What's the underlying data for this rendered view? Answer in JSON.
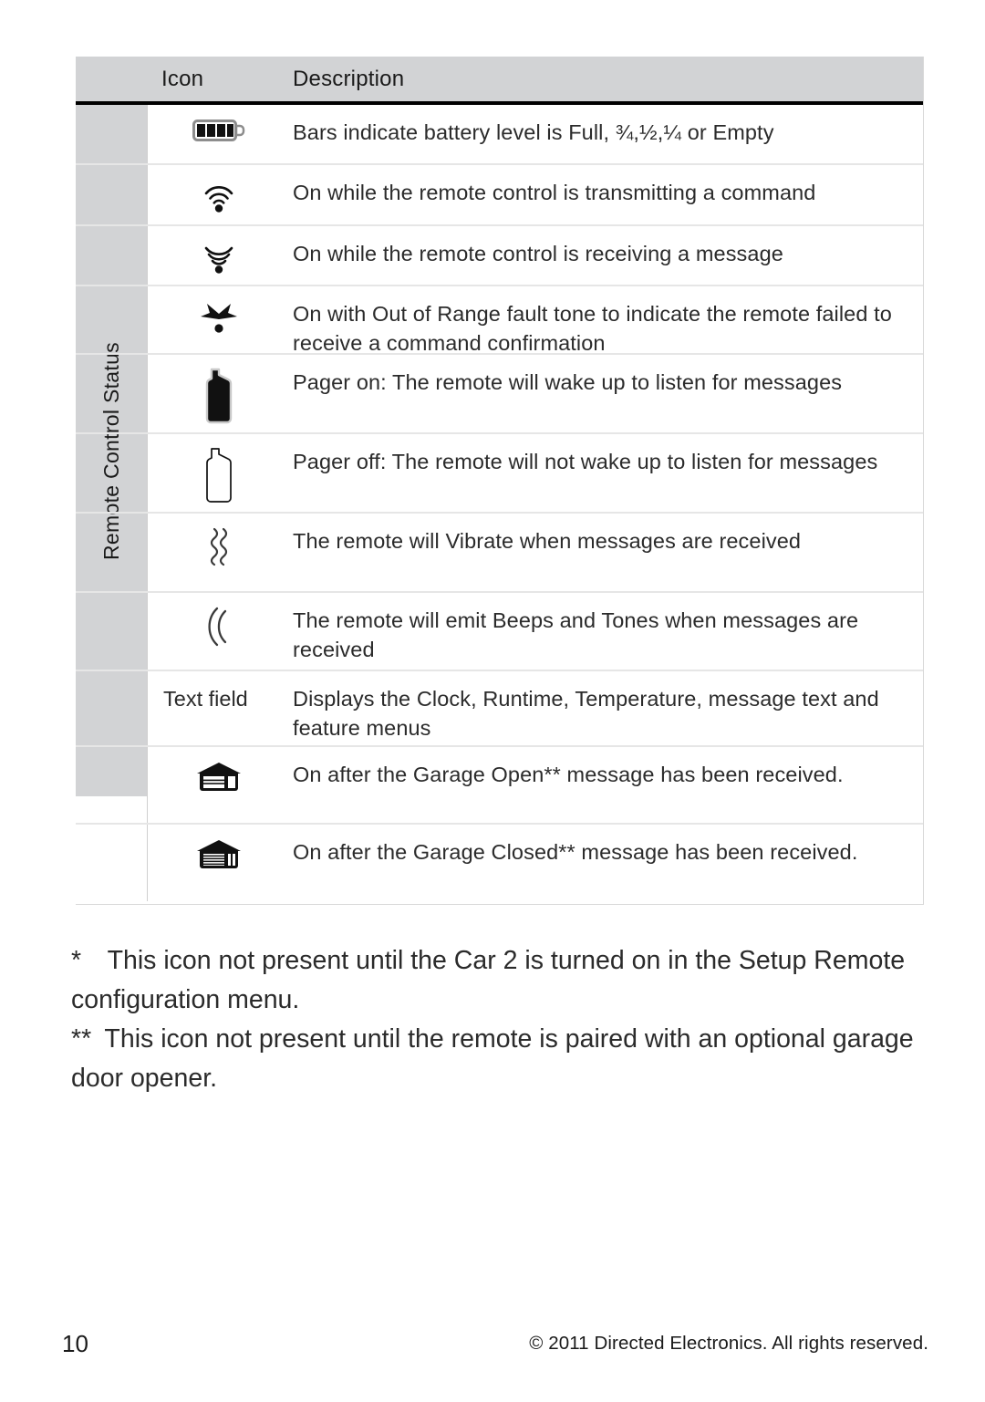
{
  "table": {
    "side_label": "Remote Control Status",
    "headers": {
      "icon": "Icon",
      "description": "Description"
    },
    "rows": [
      {
        "icon_name": "battery-level-icon",
        "icon_text": "",
        "description": "Bars indicate battery level is Full, ¾,½,¼ or Empty"
      },
      {
        "icon_name": "transmitting-signal-icon",
        "icon_text": "",
        "description": "On while the remote control is transmitting a command"
      },
      {
        "icon_name": "receiving-signal-icon",
        "icon_text": "",
        "description": "On while the remote control is receiving a message"
      },
      {
        "icon_name": "out-of-range-icon",
        "icon_text": "",
        "description": "On with Out of Range fault tone to indicate the remote failed to receive a command confirmation"
      },
      {
        "icon_name": "pager-on-icon",
        "icon_text": "",
        "description": "Pager on: The remote will wake up to listen for messages"
      },
      {
        "icon_name": "pager-off-icon",
        "icon_text": "",
        "description": "Pager off: The remote will not wake up to listen for messages"
      },
      {
        "icon_name": "vibrate-icon",
        "icon_text": "",
        "description": "The remote will Vibrate when messages are received"
      },
      {
        "icon_name": "beeps-and-tones-icon",
        "icon_text": "",
        "description": "The remote will emit Beeps and Tones when messages are received"
      },
      {
        "icon_name": "text-field-label",
        "icon_text": "Text field",
        "description": "Displays the Clock, Runtime, Temperature, message text and feature menus"
      },
      {
        "icon_name": "garage-open-icon",
        "icon_text": "",
        "description": "On after the Garage Open** message has been received."
      },
      {
        "icon_name": "garage-closed-icon",
        "icon_text": "",
        "description": "On after the Garage Closed** message has been received."
      }
    ]
  },
  "footnotes": {
    "single_star": "* This icon not present until the Car 2 is turned on in the Setup Remote configuration menu.",
    "double_star": "** This icon not present until the remote is paired with an optional garage door opener."
  },
  "footer": {
    "page_number": "10",
    "copyright": "© 2011 Directed Electronics. All rights reserved."
  }
}
